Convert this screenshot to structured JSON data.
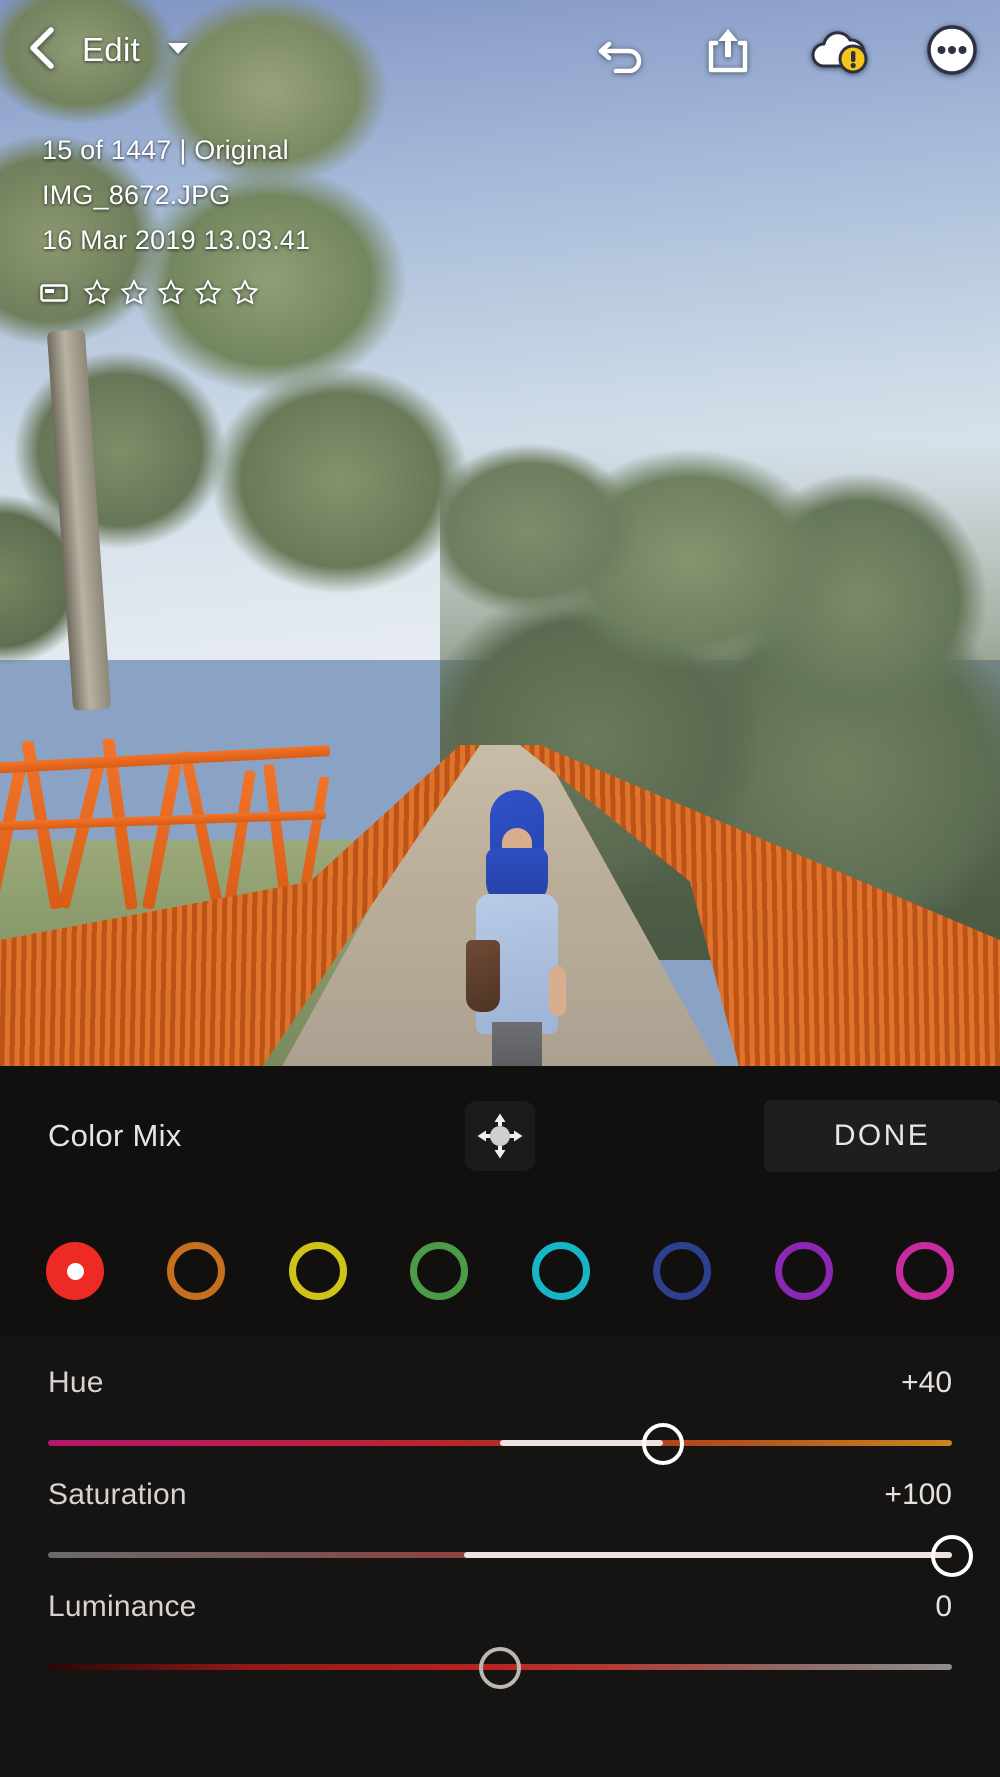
{
  "app": {
    "screen_name": "Lightroom Edit — Color Mix"
  },
  "topbar": {
    "back_icon": "chevron-left-icon",
    "title": "Edit",
    "caret_icon": "caret-down-icon",
    "actions": [
      {
        "name": "undo-icon",
        "label": "Undo"
      },
      {
        "name": "share-icon",
        "label": "Share"
      },
      {
        "name": "cloud-warning-icon",
        "label": "Sync status"
      },
      {
        "name": "more-options-icon",
        "label": "More"
      }
    ]
  },
  "photo_info": {
    "counter": "15 of 1447 | Original",
    "filename": "IMG_8672.JPG",
    "captured": "16 Mar 2019 13.03.41",
    "flag_icon": "flag-icon",
    "star_count": 5,
    "stars_filled": 0
  },
  "color_mix": {
    "title": "Color Mix",
    "target_tool_icon": "targeted-adjustment-icon",
    "done_label": "DONE",
    "selected_index": 0,
    "swatches": [
      {
        "name": "red",
        "color": "#ed2a24"
      },
      {
        "name": "orange",
        "color": "#c4701f"
      },
      {
        "name": "yellow",
        "color": "#cfc218"
      },
      {
        "name": "green",
        "color": "#4e9b47"
      },
      {
        "name": "aqua",
        "color": "#17b6c6"
      },
      {
        "name": "blue",
        "color": "#2d3f8f"
      },
      {
        "name": "purple",
        "color": "#8a28b5"
      },
      {
        "name": "magenta",
        "color": "#c62ba0"
      }
    ]
  },
  "sliders": [
    {
      "name": "Hue",
      "value": "+40",
      "percent": 68,
      "gradient": "linear-gradient(90deg, #b0186b 0%, #b81f55 18%, #b9272f 42%, #a83322 58%, #b4561c 78%, #c9851f 100%)",
      "fill_from": 50,
      "fill_to": 68,
      "knob_dim": false
    },
    {
      "name": "Saturation",
      "value": "+100",
      "percent": 100,
      "gradient": "linear-gradient(90deg, #6b6b6b 0%, #7a5353 28%, #a3332c 62%, #c03028 80%, #d63a30 100%)",
      "fill_from": 46,
      "fill_to": 100,
      "knob_dim": false
    },
    {
      "name": "Luminance",
      "value": "0",
      "percent": 50,
      "gradient": "linear-gradient(90deg, #2b0606 0%, #8f1a18 22%, #b8241f 48%, #b23b34 62%, #8f6a66 82%, #8d8d8d 100%)",
      "fill_from": 0,
      "fill_to": 0,
      "knob_dim": true
    }
  ]
}
